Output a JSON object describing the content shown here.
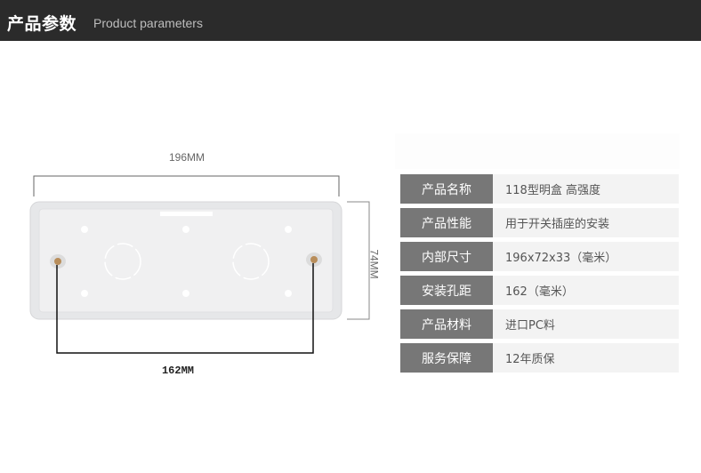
{
  "header": {
    "title_cn": "产品参数",
    "title_en": "Product parameters"
  },
  "diagram": {
    "width_label": "196MM",
    "height_label": "74MM",
    "hole_distance_label": "162MM"
  },
  "params": [
    {
      "key": "产品名称",
      "value": "118型明盒 高强度"
    },
    {
      "key": "产品性能",
      "value": "用于开关插座的安装"
    },
    {
      "key": "内部尺寸",
      "value": "196x72x33（毫米）"
    },
    {
      "key": "安装孔距",
      "value": "162（毫米）"
    },
    {
      "key": "产品材料",
      "value": "进口PC料"
    },
    {
      "key": "服务保障",
      "value": "12年质保"
    }
  ]
}
